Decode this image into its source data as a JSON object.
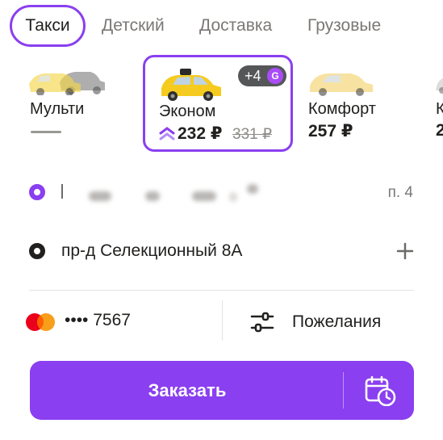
{
  "tabs": [
    {
      "label": "Такси",
      "active": true
    },
    {
      "label": "Детский",
      "active": false
    },
    {
      "label": "Доставка",
      "active": false
    },
    {
      "label": "Грузовые",
      "active": false
    }
  ],
  "tariffs": [
    {
      "name": "Мульти"
    },
    {
      "name": "Эконом",
      "price": "232 ₽",
      "old_price": "331 ₽",
      "badge": "+4",
      "selected": true
    },
    {
      "name": "Комфорт",
      "price": "257 ₽"
    },
    {
      "name": "К",
      "price": "2"
    }
  ],
  "route": {
    "from_entrance": "п. 4",
    "to_address": "пр-д Селекционный 8А"
  },
  "payment": {
    "card_masked": "•••• 7567"
  },
  "wishes": {
    "label": "Пожелания"
  },
  "order": {
    "label": "Заказать"
  },
  "colors": {
    "accent": "#8a3ff0",
    "text": "#21201f",
    "muted": "#7a7875"
  },
  "icons": {
    "payment": "mastercard-icon",
    "wishes": "sliders-icon",
    "schedule": "calendar-clock-icon",
    "add_stop": "plus-icon",
    "badge": "plus-coin-icon"
  }
}
